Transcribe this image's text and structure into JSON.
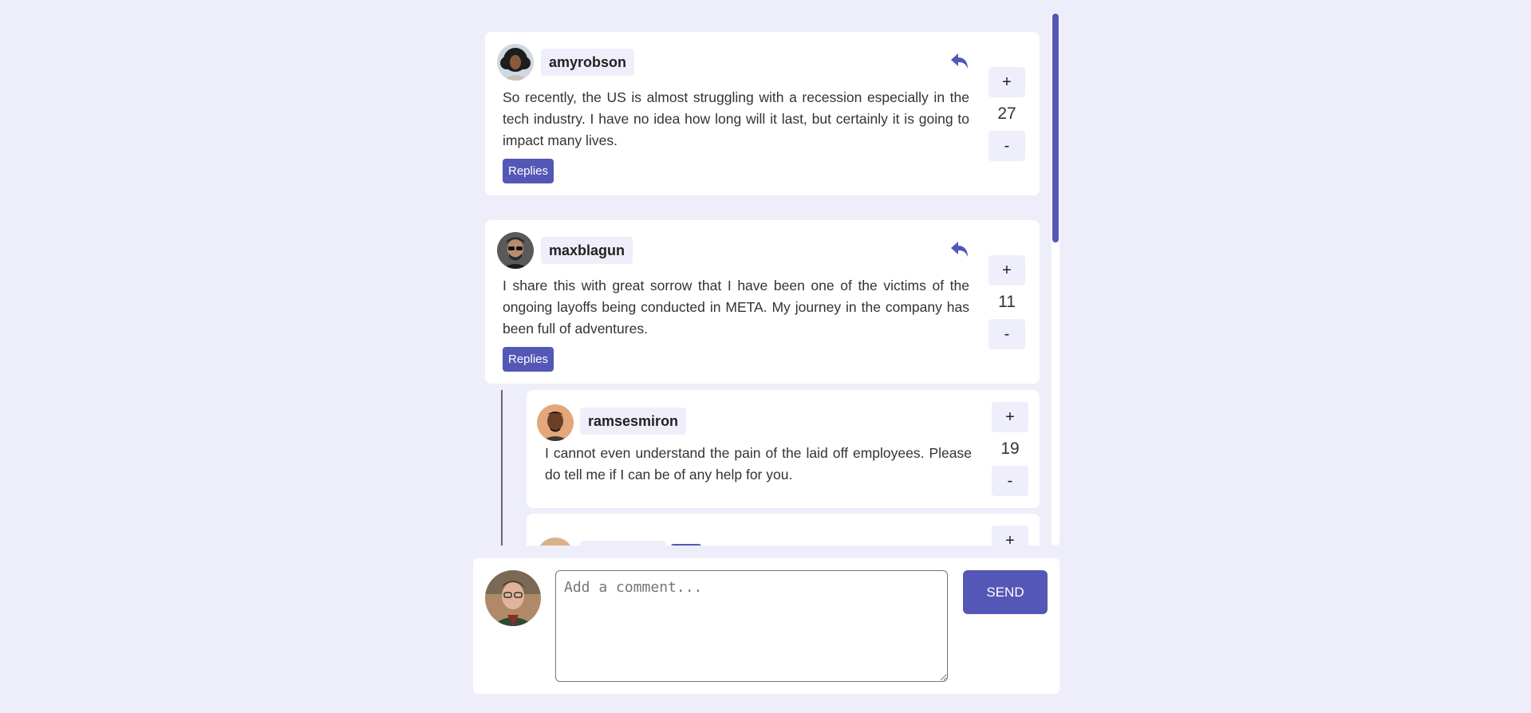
{
  "comments": [
    {
      "username": "amyrobson",
      "text": "So recently, the US is almost struggling with a recession especially in the tech industry. I have no idea how long will it last, but certainly it is going to impact many lives.",
      "score": "27",
      "replies_label": "Replies",
      "upvote_label": "+",
      "downvote_label": "-"
    },
    {
      "username": "maxblagun",
      "text": "I share this with great sorrow that I have been one of the victims of the ongoing layoffs being conducted in META. My journey in the company has been full of adventures.",
      "score": "11",
      "replies_label": "Replies",
      "upvote_label": "+",
      "downvote_label": "-",
      "replies": [
        {
          "username": "ramsesmiron",
          "text": "I cannot even understand the pain of the laid off employees. Please do tell me if I can be of any help for you.",
          "score": "19",
          "upvote_label": "+",
          "downvote_label": "-"
        },
        {
          "upvote_label": "+"
        }
      ]
    }
  ],
  "composer": {
    "placeholder": "Add a comment...",
    "send_label": "SEND"
  },
  "colors": {
    "background": "#eeeefb",
    "accent": "#5457b6",
    "chip": "#efeefb",
    "card": "#ffffff"
  },
  "icons": {
    "reply": "reply-arrow-icon"
  }
}
